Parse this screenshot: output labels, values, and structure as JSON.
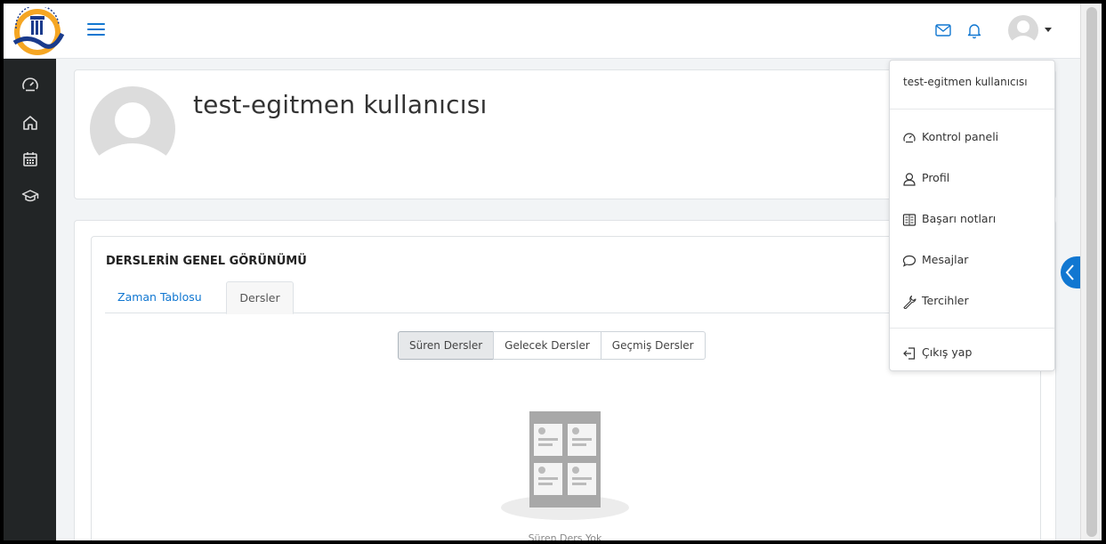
{
  "colors": {
    "accent": "#1177d1",
    "sidebar_bg": "#222526"
  },
  "navbar": {
    "logo_icon": "university-logo",
    "menu_icon": "hamburger-icon",
    "messages_icon": "mail-icon",
    "notifications_icon": "bell-icon",
    "user_menu_icon": "avatar-icon"
  },
  "sidebar": {
    "items": [
      {
        "icon": "dashboard-icon"
      },
      {
        "icon": "home-icon"
      },
      {
        "icon": "calendar-icon"
      },
      {
        "icon": "graduation-cap-icon"
      }
    ]
  },
  "profile": {
    "name": "test-egitmen kullanıcısı"
  },
  "course_overview": {
    "title": "DERSLERİN GENEL GÖRÜNÜMÜ",
    "tabs": [
      {
        "label": "Zaman Tablosu",
        "active": false
      },
      {
        "label": "Dersler",
        "active": true
      }
    ],
    "filters": [
      {
        "label": "Süren Dersler",
        "active": true
      },
      {
        "label": "Gelecek Dersler",
        "active": false
      },
      {
        "label": "Geçmiş Dersler",
        "active": false
      }
    ],
    "empty_message": "Süren Ders Yok"
  },
  "user_menu": {
    "header": "test-egitmen kullanıcısı",
    "items": [
      {
        "label": "Kontrol paneli",
        "icon": "dashboard-icon"
      },
      {
        "label": "Profil",
        "icon": "user-icon"
      },
      {
        "label": "Başarı notları",
        "icon": "grades-icon"
      },
      {
        "label": "Mesajlar",
        "icon": "chat-bubble-icon"
      },
      {
        "label": "Tercihler",
        "icon": "wrench-icon"
      },
      {
        "label": "Çıkış yap",
        "icon": "logout-icon"
      }
    ]
  }
}
